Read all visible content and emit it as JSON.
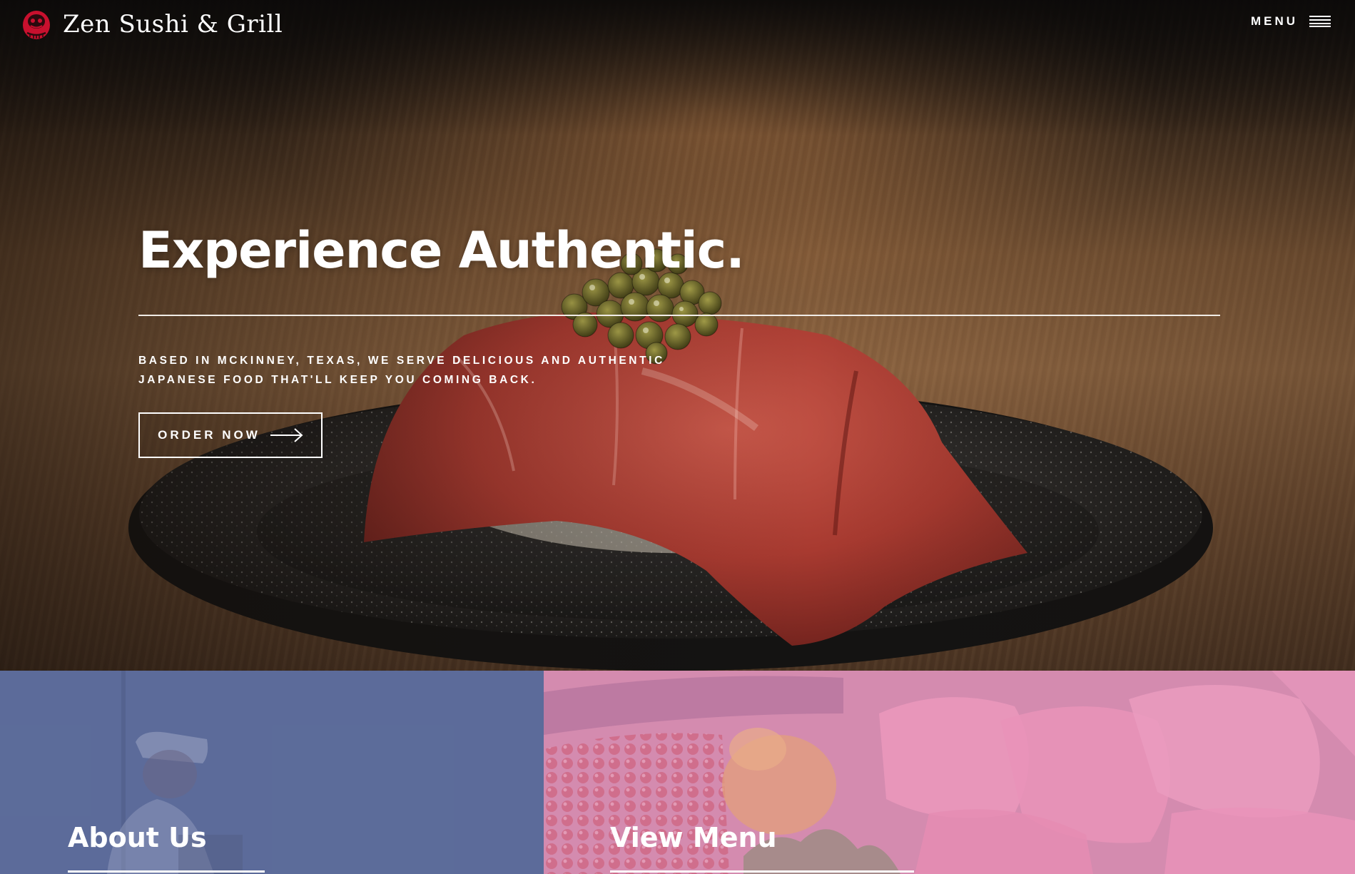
{
  "header": {
    "brand_name": "Zen Sushi & Grill",
    "logo_icon": "daruma-icon",
    "menu_label": "MENU",
    "menu_icon": "hamburger-icon"
  },
  "hero": {
    "title": "Experience Authentic.",
    "tagline": "Based in McKinney, Texas, we serve delicious and authentic Japanese food that'll keep you coming back.",
    "cta_label": "ORDER NOW",
    "cta_icon": "arrow-right-icon"
  },
  "panels": [
    {
      "title": "About Us"
    },
    {
      "title": "View Menu"
    }
  ],
  "colors": {
    "brand_red": "#c8102e",
    "about_panel": "#5c6c9a",
    "menu_panel": "#d88fb0",
    "text": "#ffffff"
  }
}
